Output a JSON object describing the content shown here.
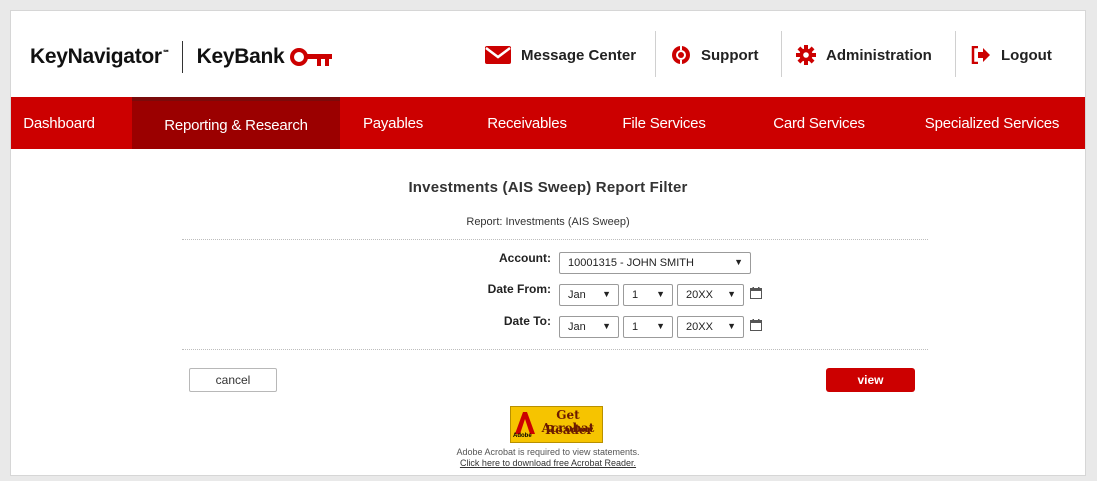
{
  "brand": {
    "product": "KeyNavigator",
    "product_mark": "℠",
    "bank": "KeyBank"
  },
  "utility_nav": [
    {
      "label": "Message Center",
      "icon": "envelope-icon"
    },
    {
      "label": "Support",
      "icon": "lifebuoy-icon"
    },
    {
      "label": "Administration",
      "icon": "gear-icon"
    },
    {
      "label": "Logout",
      "icon": "logout-arrow-icon"
    }
  ],
  "main_nav": [
    {
      "label": "Dashboard",
      "active": false
    },
    {
      "label": "Reporting & Research",
      "active": true
    },
    {
      "label": "Payables",
      "active": false
    },
    {
      "label": "Receivables",
      "active": false
    },
    {
      "label": "File Services",
      "active": false
    },
    {
      "label": "Card Services",
      "active": false
    },
    {
      "label": "Specialized Services",
      "active": false
    }
  ],
  "page": {
    "title": "Investments (AIS Sweep) Report Filter",
    "subtitle": "Report: Investments (AIS Sweep)"
  },
  "form": {
    "account": {
      "label": "Account:",
      "value": "10001315 - JOHN SMITH"
    },
    "date_from": {
      "label": "Date From:",
      "month": "Jan",
      "day": "1",
      "year": "20XX"
    },
    "date_to": {
      "label": "Date To:",
      "month": "Jan",
      "day": "1",
      "year": "20XX"
    }
  },
  "buttons": {
    "cancel": "cancel",
    "view": "view"
  },
  "acrobat": {
    "badge_line1": "Get Acrobat",
    "badge_line2": "Reader",
    "badge_brand": "Adobe",
    "note": "Adobe Acrobat is required to view statements.",
    "link": "Click here to download free Acrobat Reader."
  },
  "colors": {
    "brand_red": "#cc0000",
    "active_nav": "#9b0000",
    "acrobat_yellow": "#f6c400"
  }
}
